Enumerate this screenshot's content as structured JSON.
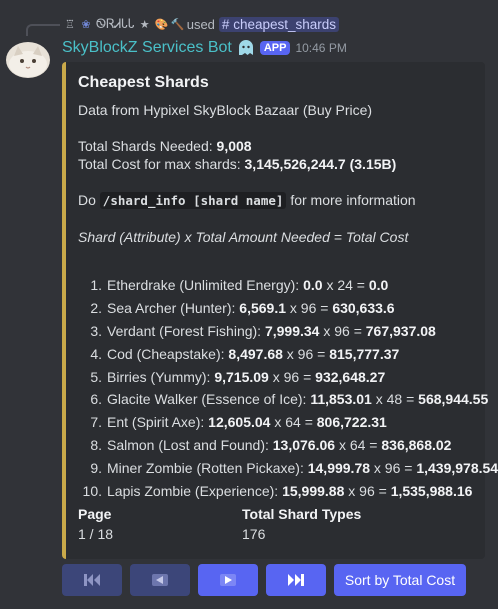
{
  "reply": {
    "username": "ᏫᏒᏗᏓᏓ",
    "used_label": "used",
    "command": "cheapest_shards"
  },
  "message": {
    "bot_name": "SkyBlockZ Services Bot",
    "badge": "APP",
    "timestamp": "10:46 PM"
  },
  "embed": {
    "accent_color": "#c9a94a",
    "title": "Cheapest Shards",
    "source": "Data from Hypixel SkyBlock Bazaar (Buy Price)",
    "total_needed_label": "Total Shards Needed:",
    "total_needed_value": "9,008",
    "total_cost_label": "Total Cost for max shards:",
    "total_cost_value": "3,145,526,244.7 (3.15B)",
    "info_prefix": "Do",
    "info_code": "/shard_info [shard name]",
    "info_suffix": "for more information",
    "formula": "Shard (Attribute) x Total Amount Needed = Total Cost",
    "shards": [
      {
        "num": "1.",
        "name": "Etherdrake (Unlimited Energy):",
        "price": "0.0",
        "qty": "x 24 =",
        "total": "0.0"
      },
      {
        "num": "2.",
        "name": "Sea Archer (Hunter):",
        "price": "6,569.1",
        "qty": "x 96 =",
        "total": "630,633.6"
      },
      {
        "num": "3.",
        "name": "Verdant (Forest Fishing):",
        "price": "7,999.34",
        "qty": "x 96 =",
        "total": "767,937.08"
      },
      {
        "num": "4.",
        "name": "Cod (Cheapstake):",
        "price": "8,497.68",
        "qty": "x 96 =",
        "total": "815,777.37"
      },
      {
        "num": "5.",
        "name": "Birries (Yummy):",
        "price": "9,715.09",
        "qty": "x 96 =",
        "total": "932,648.27"
      },
      {
        "num": "6.",
        "name": "Glacite Walker (Essence of Ice):",
        "price": "11,853.01",
        "qty": "x 48 =",
        "total": "568,944.55"
      },
      {
        "num": "7.",
        "name": "Ent (Spirit Axe):",
        "price": "12,605.04",
        "qty": "x 64 =",
        "total": "806,722.31"
      },
      {
        "num": "8.",
        "name": "Salmon (Lost and Found):",
        "price": "13,076.06",
        "qty": "x 64 =",
        "total": "836,868.02"
      },
      {
        "num": "9.",
        "name": "Miner Zombie (Rotten Pickaxe):",
        "price": "14,999.78",
        "qty": "x 96 =",
        "total": "1,439,978.54"
      },
      {
        "num": "10.",
        "name": "Lapis Zombie (Experience):",
        "price": "15,999.88",
        "qty": "x 96 =",
        "total": "1,535,988.16"
      }
    ],
    "fields": {
      "page_label": "Page",
      "page_value": "1 / 18",
      "types_label": "Total Shard Types",
      "types_value": "176"
    }
  },
  "buttons": {
    "first_icon": "skip-first-icon",
    "prev_icon": "prev-icon",
    "next_icon": "next-icon",
    "last_icon": "skip-last-icon",
    "sort_label": "Sort by Total Cost"
  }
}
